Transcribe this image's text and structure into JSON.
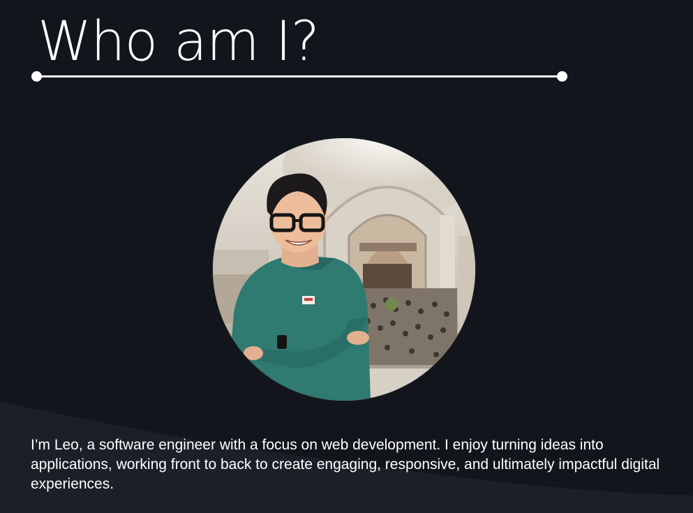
{
  "section": {
    "heading": "Who am I?",
    "bio": "I’m Leo, a software engineer with a focus on web development. I enjoy turning ideas into applications, working front to back to create engaging, responsive, and ultimately impactful digital experiences."
  },
  "colors": {
    "background": "#12161c",
    "wave": "#1b2028",
    "text": "#ffffff",
    "shirt": "#2f7a71"
  }
}
